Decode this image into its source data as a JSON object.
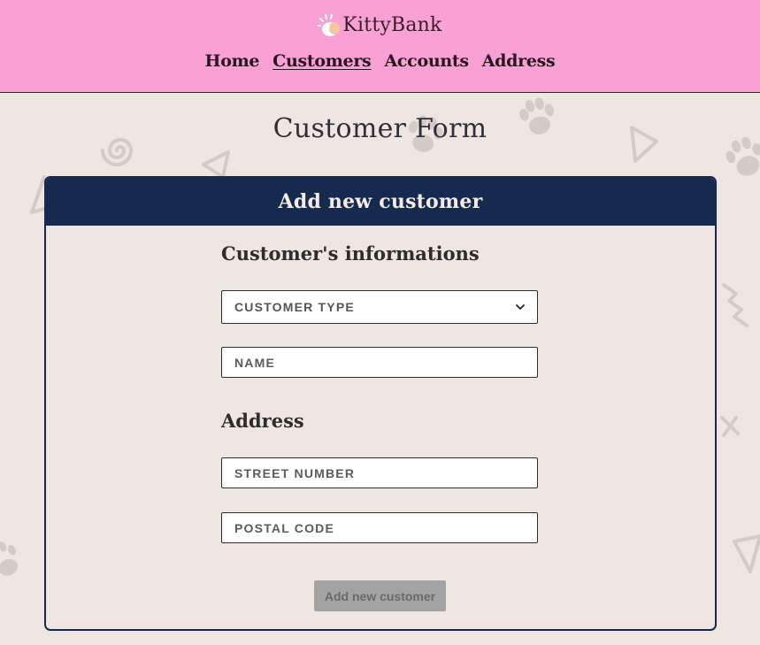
{
  "brand": {
    "name": "KittyBank"
  },
  "nav": {
    "items": [
      {
        "label": "Home",
        "active": false
      },
      {
        "label": "Customers",
        "active": true
      },
      {
        "label": "Accounts",
        "active": false
      },
      {
        "label": "Address",
        "active": false
      }
    ]
  },
  "page": {
    "title": "Customer Form"
  },
  "form": {
    "card_title": "Add new customer",
    "info_section_title": "Customer's informations",
    "customer_type": {
      "selected": "CUSTOMER TYPE"
    },
    "name": {
      "placeholder": "NAME",
      "value": ""
    },
    "address_section_title": "Address",
    "street_number": {
      "placeholder": "STREET NUMBER",
      "value": ""
    },
    "postal_code": {
      "placeholder": "POSTAL CODE",
      "value": ""
    },
    "submit_label": "Add new customer"
  },
  "colors": {
    "header_bg": "#f9a1d4",
    "page_bg": "#efe5e1",
    "card_accent": "#152a4e",
    "button_disabled": "#a3a3a3"
  },
  "icons": [
    "cat-paw-logo-icon",
    "chevron-down-icon",
    "paw-print-icon",
    "triangle-icon",
    "spiral-icon",
    "squiggle-icon",
    "cross-icon"
  ]
}
